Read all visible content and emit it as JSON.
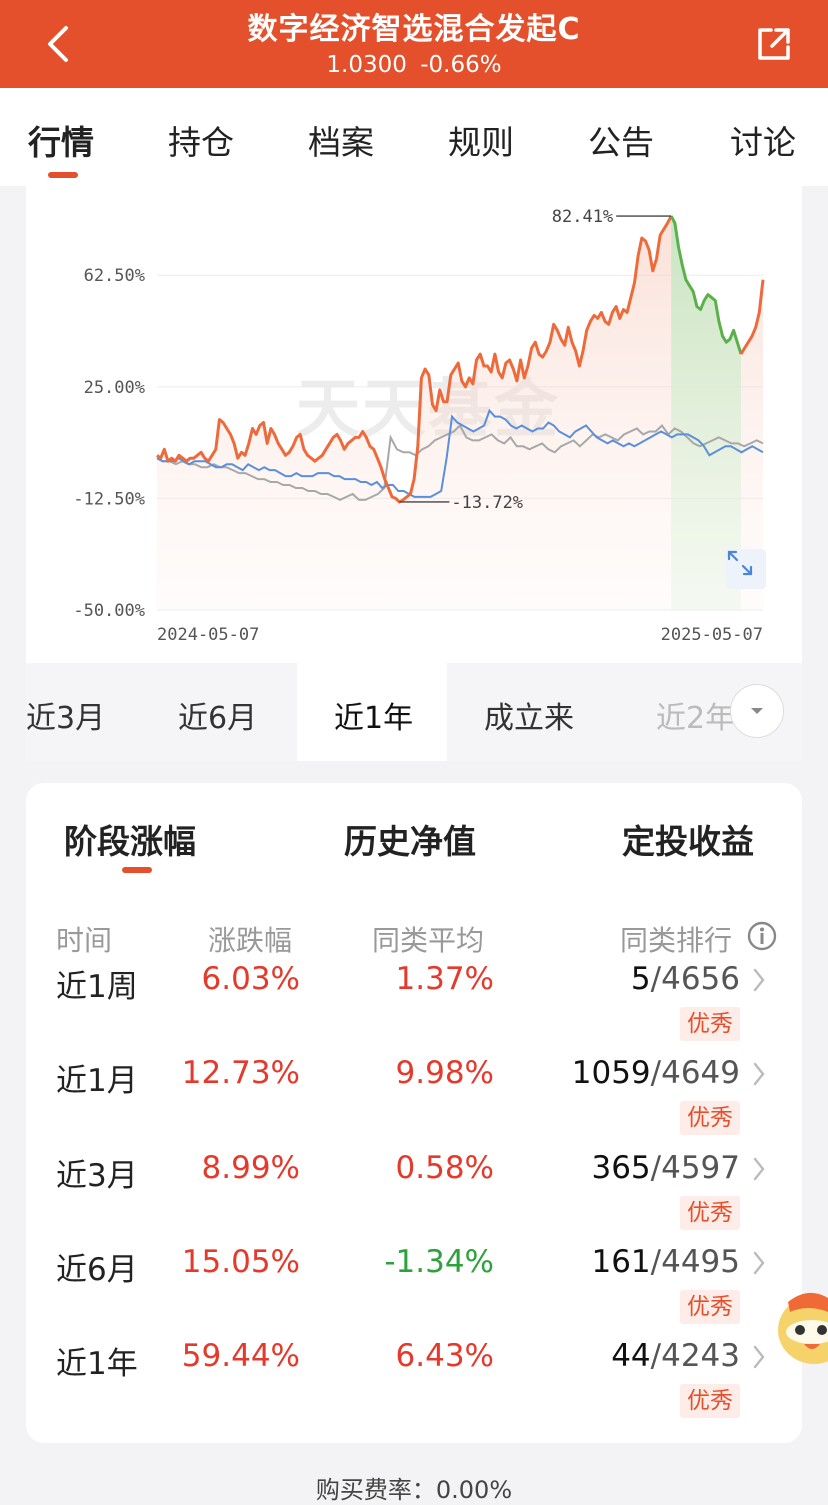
{
  "header": {
    "title": "数字经济智选混合发起C",
    "nav_value": "1.0300",
    "change": "-0.66%"
  },
  "tabs": [
    "行情",
    "持仓",
    "档案",
    "规则",
    "公告",
    "讨论"
  ],
  "chart": {
    "watermark": "天天基金",
    "y_ticks": [
      "62.50%",
      "25.00%",
      "-12.50%",
      "-50.00%"
    ],
    "x_start": "2024-05-07",
    "x_end": "2025-05-07",
    "max_label": "82.41%",
    "min_label": "-13.72%"
  },
  "chart_data": {
    "type": "line",
    "x_start": "2024-05-07",
    "x_end": "2025-05-07",
    "ylim": [
      -50,
      82.41
    ],
    "y_ticks": [
      62.5,
      25.0,
      -12.5,
      -50.0
    ],
    "annotations": [
      {
        "text": "82.41%",
        "value": 82.41
      },
      {
        "text": "-13.72%",
        "value": -13.72
      }
    ],
    "series": [
      {
        "color": "#ee6a3b",
        "values": [
          2,
          1,
          4,
          0,
          1,
          0,
          2,
          1,
          0,
          1,
          1,
          2,
          3,
          1,
          0,
          2,
          4,
          14,
          13,
          11,
          9,
          6,
          1,
          3,
          2,
          6,
          11,
          9,
          12,
          13,
          6,
          11,
          9,
          6,
          4,
          2,
          3,
          5,
          8,
          9,
          4,
          2,
          1,
          0,
          1,
          2,
          4,
          6,
          8,
          9,
          7,
          4,
          6,
          7,
          8,
          8,
          10,
          8,
          5,
          4,
          1,
          -2,
          -6,
          -9,
          -12,
          -12.5,
          -13.7,
          -13,
          -12,
          -11,
          -6,
          5,
          28,
          31,
          29,
          19,
          17,
          24,
          20,
          20,
          29,
          31,
          33,
          27,
          25,
          28,
          26,
          34,
          36,
          32,
          32,
          30,
          36,
          30,
          28,
          33,
          34,
          31,
          27,
          34,
          28,
          32,
          38,
          40,
          36,
          35,
          37,
          40,
          46,
          44,
          41,
          39,
          45,
          40,
          37,
          32,
          37,
          44,
          47,
          49,
          48,
          50,
          47,
          46,
          50,
          52,
          48,
          51,
          50,
          55,
          60,
          69,
          75,
          74,
          71,
          64,
          68,
          76,
          78,
          80,
          82.4,
          80,
          72,
          66,
          61,
          59,
          57,
          52,
          51,
          54,
          56,
          55,
          54,
          47,
          42,
          40,
          41,
          44,
          40,
          36,
          38,
          40,
          42,
          45,
          50,
          61
        ]
      },
      {
        "color": "#5b8fdb",
        "values": [
          1,
          0,
          0,
          0,
          1,
          0,
          -1,
          0,
          0,
          0,
          -1,
          -2,
          -2,
          -1,
          -1,
          -2,
          -3,
          -1,
          -2,
          -3,
          -2,
          -3,
          -3,
          -4,
          -5,
          -5,
          -4,
          -5,
          -5,
          -5,
          -4,
          -4,
          -4,
          -5,
          -5,
          -6,
          -6,
          -6,
          -7,
          -7,
          -8,
          -7,
          -9,
          -8,
          -8,
          -10,
          -10,
          -11,
          -12,
          -12,
          -12,
          -12,
          -11,
          -10,
          1,
          15,
          13,
          12,
          11,
          10,
          11,
          12,
          17,
          15,
          15,
          14,
          12,
          11,
          12,
          11,
          10,
          11,
          11,
          13,
          12,
          10,
          9,
          8,
          10,
          11,
          12,
          10,
          8,
          7,
          6,
          7,
          6,
          5,
          6,
          5,
          6,
          7,
          8,
          9,
          10,
          9,
          8,
          9,
          9,
          9,
          8,
          7,
          5,
          2,
          3,
          4,
          5,
          5,
          4,
          3,
          4,
          5,
          4,
          3
        ]
      },
      {
        "color": "#a8a8a8",
        "values": [
          1,
          0,
          0,
          -1,
          0,
          -1,
          -1,
          -2,
          -2,
          -1,
          -2,
          -2,
          -3,
          -4,
          -4,
          -5,
          -6,
          -6,
          -7,
          -7,
          -8,
          -8,
          -9,
          -9,
          -10,
          -10,
          -11,
          -11,
          -12,
          -13,
          -12,
          -11,
          -13,
          -13,
          -12,
          -11,
          -9,
          8,
          4,
          3,
          3,
          2,
          4,
          5,
          7,
          8,
          9,
          10,
          12,
          8,
          7,
          7,
          8,
          9,
          7,
          6,
          8,
          5,
          5,
          4,
          5,
          6,
          4,
          3,
          5,
          6,
          7,
          5,
          7,
          9,
          8,
          9,
          8,
          7,
          9,
          10,
          11,
          9,
          10,
          10,
          12,
          9,
          11,
          10,
          8,
          6,
          5,
          6,
          7,
          8,
          7,
          6,
          6,
          5,
          6,
          7,
          6
        ]
      }
    ]
  },
  "range": {
    "items": [
      "近3月",
      "近6月",
      "近1年",
      "成立来",
      "近2年"
    ],
    "active": "近1年"
  },
  "stats": {
    "sub_tabs": [
      "阶段涨幅",
      "历史净值",
      "定投收益"
    ],
    "headers": [
      "时间",
      "涨跌幅",
      "同类平均",
      "同类排行"
    ],
    "rows": [
      {
        "period": "近1周",
        "change": "6.03%",
        "avg": "1.37%",
        "rank": "5",
        "total": "/4656",
        "badge": "优秀"
      },
      {
        "period": "近1月",
        "change": "12.73%",
        "avg": "9.98%",
        "rank": "1059",
        "total": "/4649",
        "badge": "优秀"
      },
      {
        "period": "近3月",
        "change": "8.99%",
        "avg": "0.58%",
        "rank": "365",
        "total": "/4597",
        "badge": "优秀"
      },
      {
        "period": "近6月",
        "change": "15.05%",
        "avg": "-1.34%",
        "rank": "161",
        "total": "/4495",
        "badge": "优秀"
      },
      {
        "period": "近1年",
        "change": "59.44%",
        "avg": "6.43%",
        "rank": "44",
        "total": "/4243",
        "badge": "优秀"
      }
    ]
  },
  "footer": {
    "fee_label": "购买费率：",
    "fee_value": "0.00%"
  },
  "colors": {
    "brand": "#e4502b",
    "up": "#e4392b",
    "down": "#2ea23a"
  }
}
